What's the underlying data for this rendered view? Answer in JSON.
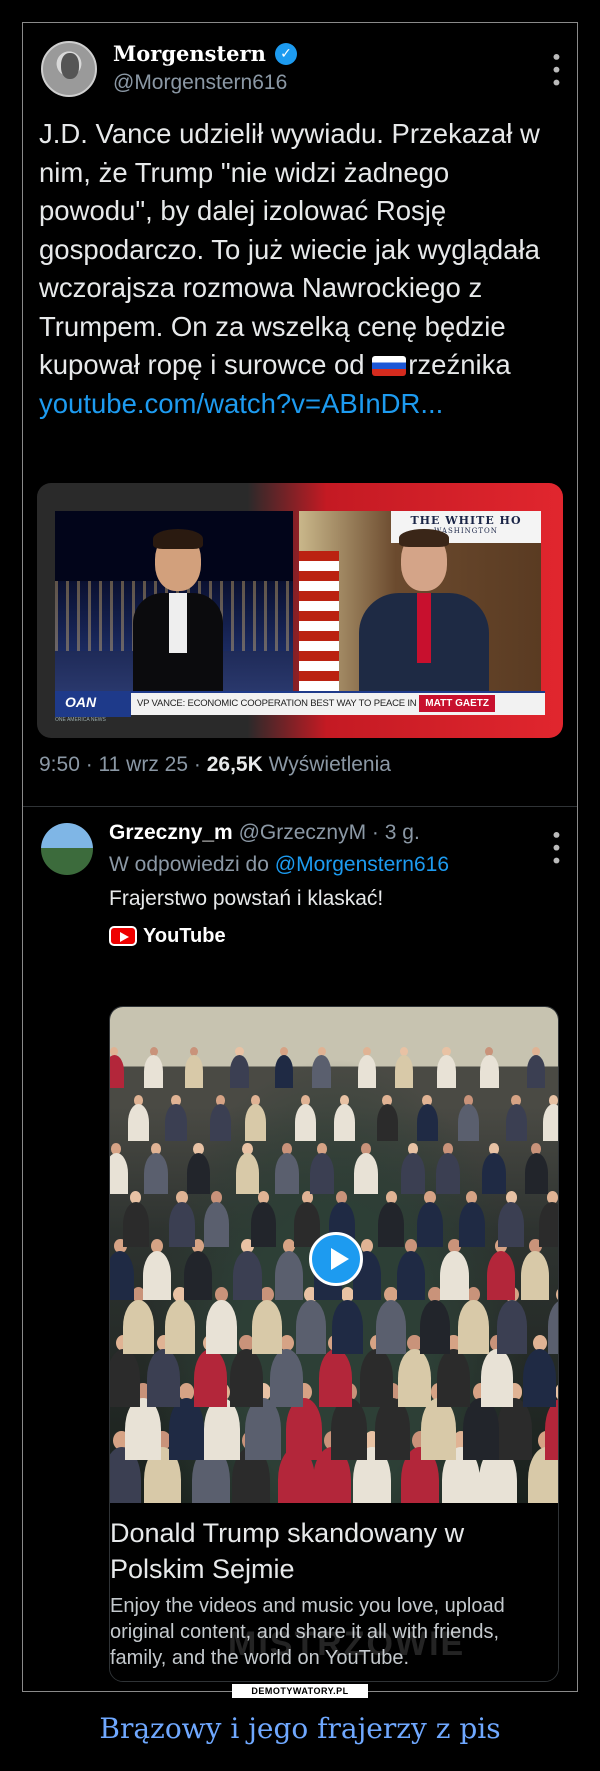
{
  "tweet": {
    "name": "Morgenstern",
    "verified_icon": "verified-check-icon",
    "handle": "@Morgenstern616",
    "text_before_flag": "J.D. Vance udzielił wywiadu. Przekazał w nim, że Trump \"nie widzi żadnego powodu\", by dalej izolować Rosję gospodarczo. To już wiecie jak wyglądała wczorajsza rozmowa Nawrockiego z Trumpem. On za wszelką cenę będzie kupował ropę i surowce od ",
    "text_after_flag": "rzeźnika ",
    "link": "youtube.com/watch?v=ABInDR...",
    "flag_icon": "russian-flag-icon",
    "video": {
      "overlay_title": "THE WHITE HO",
      "overlay_sub": "WASHINGTON",
      "channel_logo": "OAN",
      "channel_sub": "ONE AMERICA NEWS",
      "ticker": "VP VANCE: ECONOMIC COOPERATION BEST WAY TO PEACE IN UKRAINE",
      "show": "MATT GAETZ"
    },
    "time": "9:50",
    "date": "11 wrz 25",
    "views": "26,5K",
    "views_label": "Wyświetlenia"
  },
  "reply": {
    "name": "Grzeczny_m",
    "handle": "@GrzecznyM",
    "age": "3 g.",
    "reply_prefix": "W odpowiedzi do ",
    "reply_to": "@Morgenstern616",
    "text": "Frajerstwo powstań i klaskać!",
    "source_label": "YouTube",
    "card": {
      "title": "Donald Trump skandowany w Polskim Sejmie",
      "description": "Enjoy the videos and music you love, upload original content, and share it all with friends, family, and the world on YouTube."
    }
  },
  "watermark": "MISTRZOWIE",
  "footer": {
    "site": "DEMOTYWATORY.PL",
    "caption": "Brązowy i jego frajerzy z pis"
  },
  "colors": {
    "link": "#1d9bf0",
    "caption": "#6fa8ff",
    "background": "#000000"
  }
}
